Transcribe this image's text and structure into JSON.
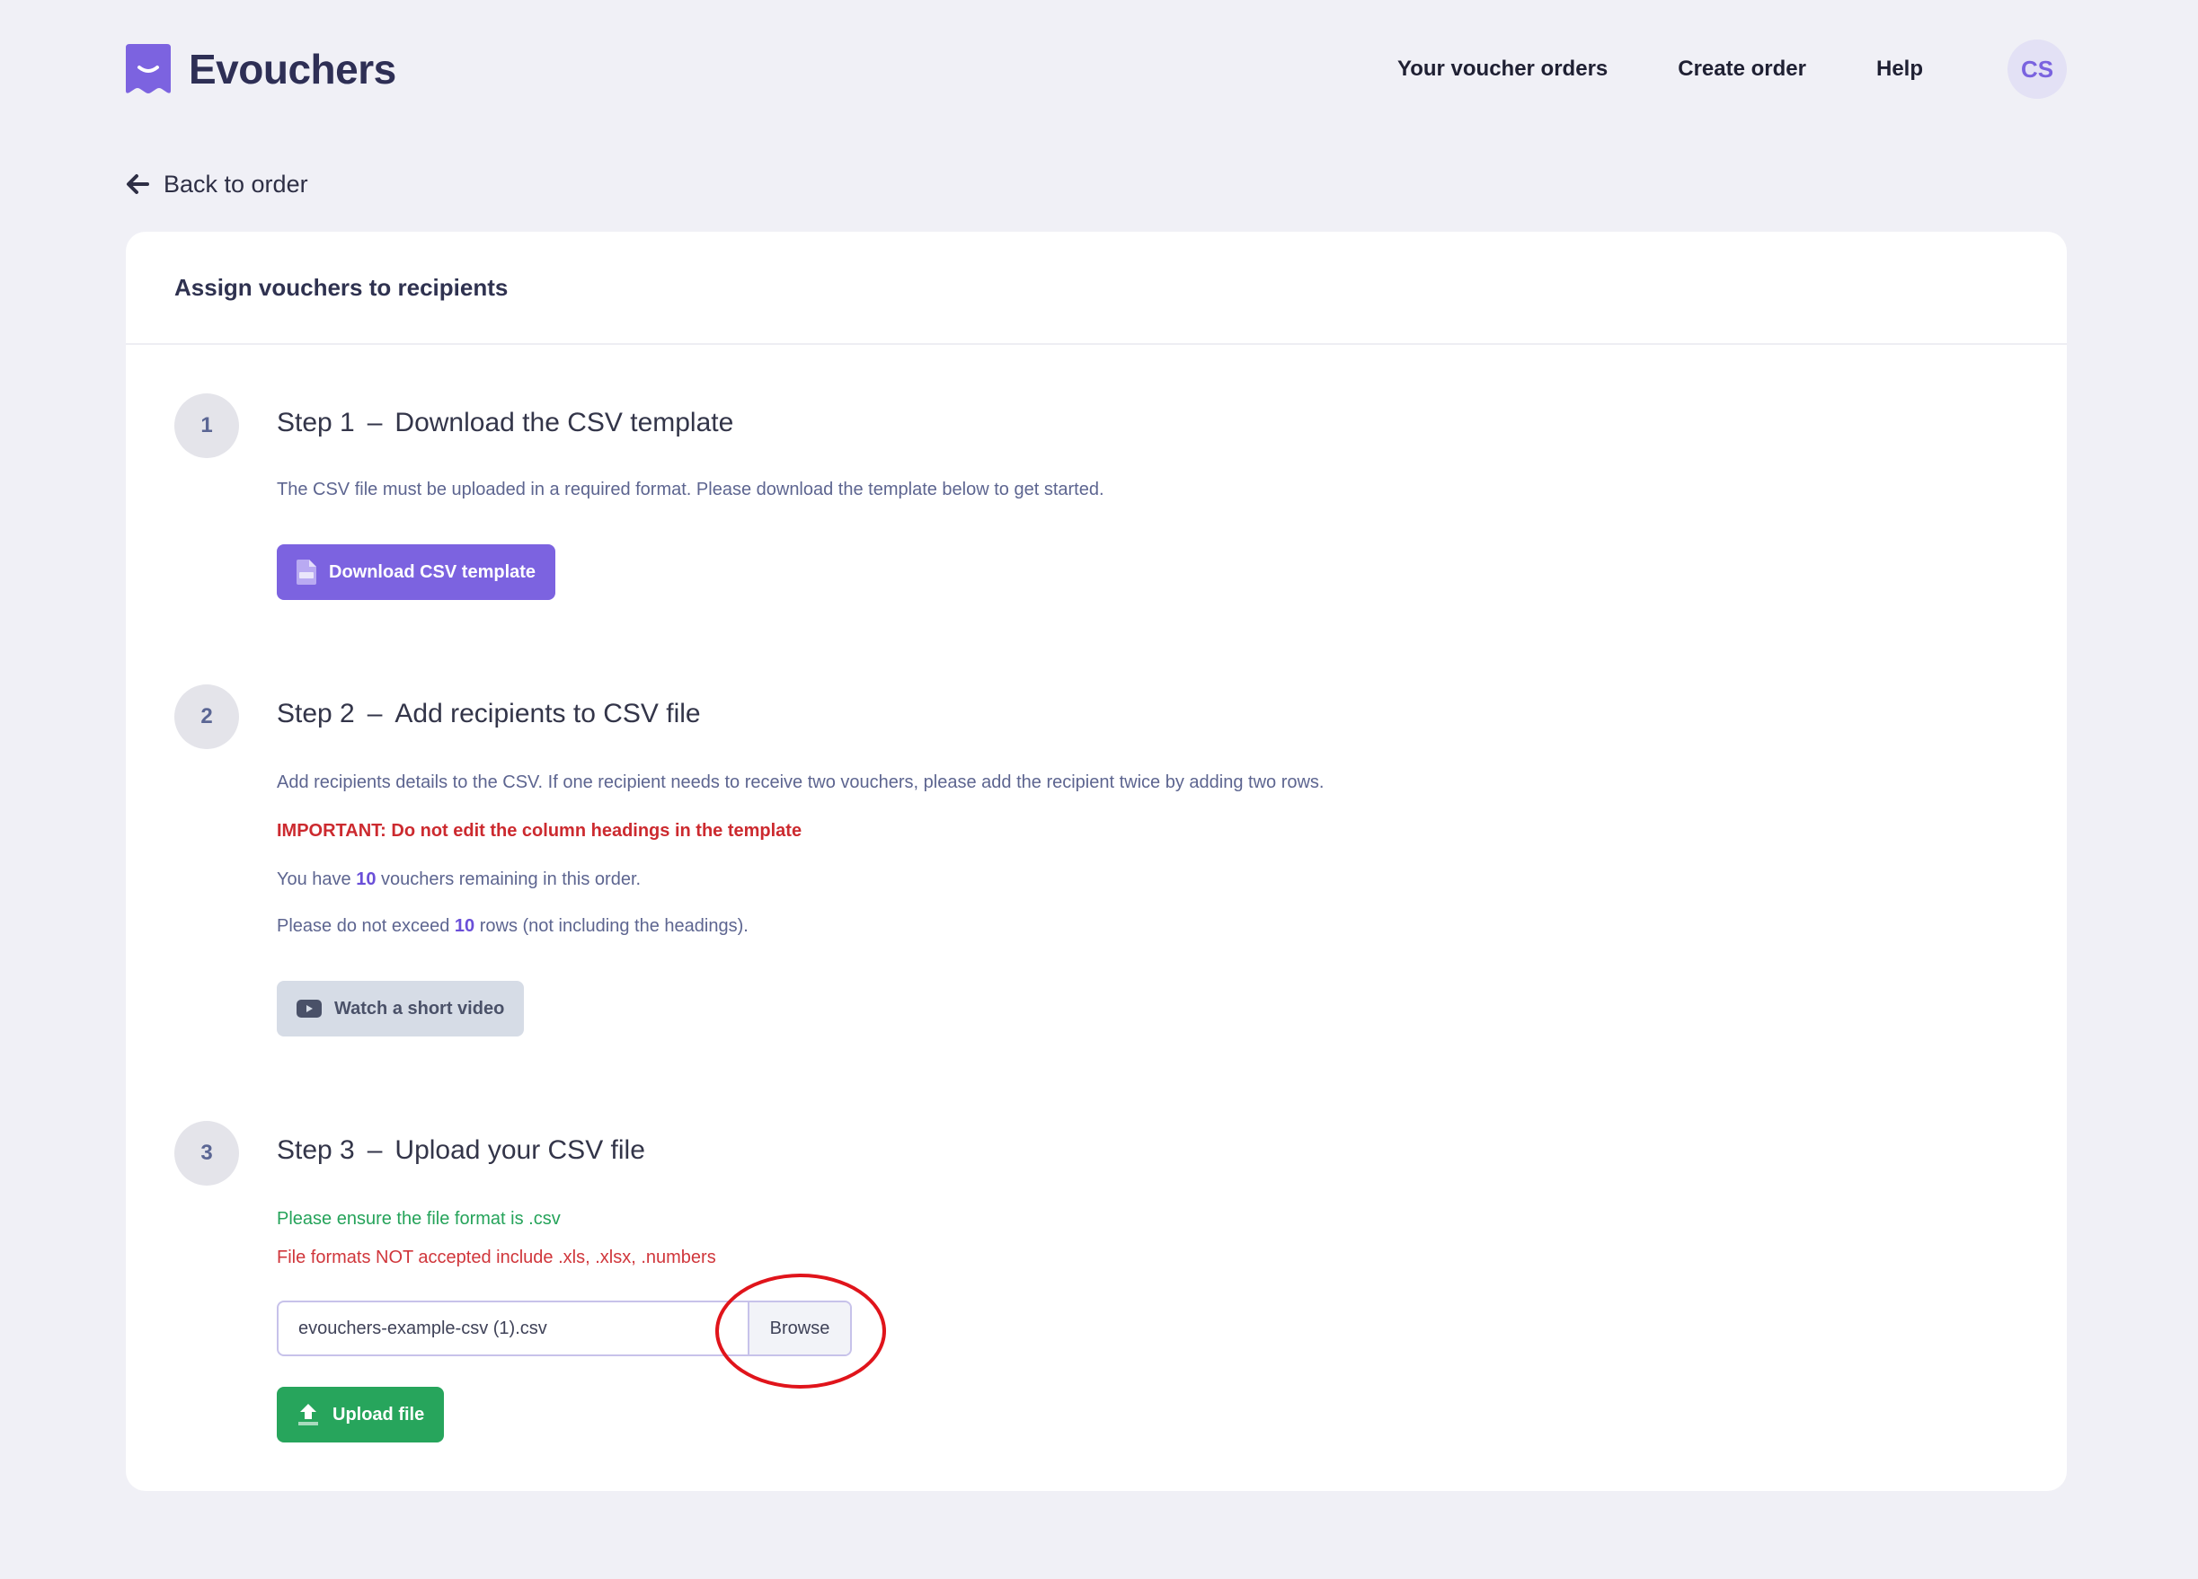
{
  "brand": {
    "name": "Evouchers",
    "accent": "#7c63e0"
  },
  "nav": {
    "orders": "Your voucher orders",
    "create": "Create order",
    "help": "Help",
    "avatar_initials": "CS"
  },
  "back": {
    "label": "Back to order"
  },
  "card": {
    "title": "Assign vouchers to recipients"
  },
  "step1": {
    "number": "1",
    "label": "Step 1",
    "dash": "–",
    "title": "Download the CSV template",
    "desc": "The CSV file must be uploaded in a required format. Please download the template below to get started.",
    "button": "Download CSV template",
    "icon": "csv-file-icon"
  },
  "step2": {
    "number": "2",
    "label": "Step 2",
    "dash": "–",
    "title": "Add recipients to CSV file",
    "desc": "Add recipients details to the CSV. If one recipient needs to receive two vouchers, please add the recipient twice by adding two rows.",
    "important": "IMPORTANT: Do not edit the column headings in the template",
    "remaining_prefix": "You have ",
    "remaining_count": "10",
    "remaining_suffix": " vouchers remaining in this order.",
    "rows_prefix": "Please do not exceed ",
    "rows_count": "10",
    "rows_suffix": " rows (not including the headings).",
    "video_button": "Watch a short video",
    "icon": "video-play-icon"
  },
  "step3": {
    "number": "3",
    "label": "Step 3",
    "dash": "–",
    "title": "Upload your CSV file",
    "note_ok": "Please ensure the file format is .csv",
    "note_bad": "File formats NOT accepted include .xls, .xlsx, .numbers",
    "file_value": "evouchers-example-csv (1).csv",
    "browse": "Browse",
    "upload_button": "Upload file",
    "icon": "upload-icon"
  },
  "colors": {
    "background": "#f0f0f6",
    "primary": "#7c63e0",
    "success": "#27a55c",
    "danger": "#cc2a2f",
    "annotation": "#e0141b"
  }
}
